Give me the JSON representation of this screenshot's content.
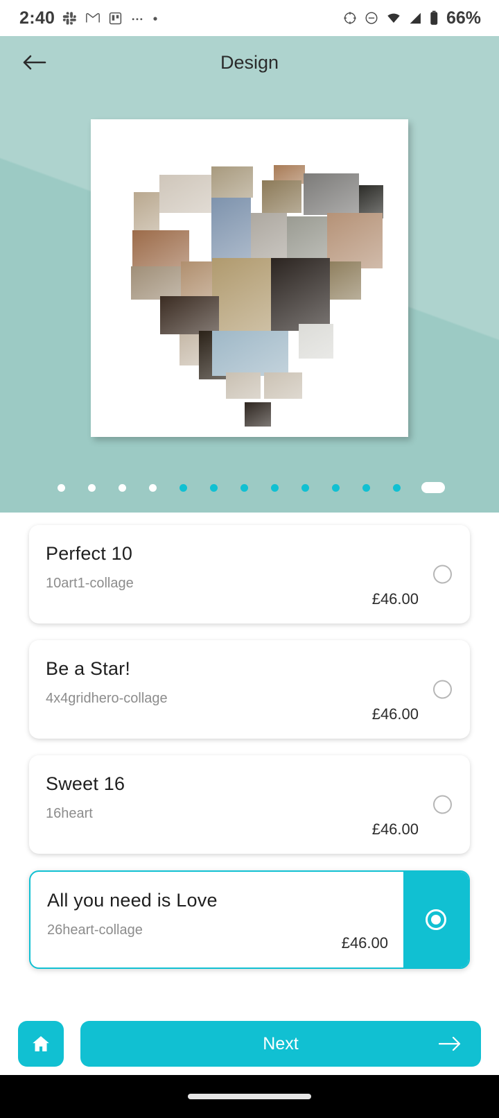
{
  "status_bar": {
    "time": "2:40",
    "battery_text": "66%",
    "left_icons": [
      "slack-icon",
      "gmail-icon",
      "trello-icon",
      "more-dots-icon",
      "dot-icon"
    ],
    "right_icons": [
      "location-icon",
      "dnd-icon",
      "wifi-icon",
      "signal-icon",
      "battery-icon"
    ]
  },
  "app_bar": {
    "title": "Design",
    "back_icon": "back-arrow-icon"
  },
  "preview": {
    "layout_name": "26heart-collage",
    "background_color": "#a5cfc9",
    "canvas_color": "#ffffff"
  },
  "pager": {
    "total": 13,
    "active_index": 12,
    "inactive_color": "#ffffff",
    "visited_color": "#11c0d2",
    "dots": [
      "white",
      "white",
      "white",
      "white",
      "teal",
      "teal",
      "teal",
      "teal",
      "teal",
      "teal",
      "teal",
      "teal",
      "active"
    ]
  },
  "options": [
    {
      "title": "Perfect 10",
      "code": "10art1-collage",
      "price": "£46.00",
      "selected": false
    },
    {
      "title": "Be a Star!",
      "code": "4x4gridhero-collage",
      "price": "£46.00",
      "selected": false
    },
    {
      "title": "Sweet 16",
      "code": "16heart",
      "price": "£46.00",
      "selected": false
    },
    {
      "title": "All you need is Love",
      "code": "26heart-collage",
      "price": "£46.00",
      "selected": true
    }
  ],
  "bottom_bar": {
    "home_icon": "home-icon",
    "next_label": "Next",
    "next_icon": "arrow-right-icon",
    "accent_color": "#11c0d2"
  }
}
